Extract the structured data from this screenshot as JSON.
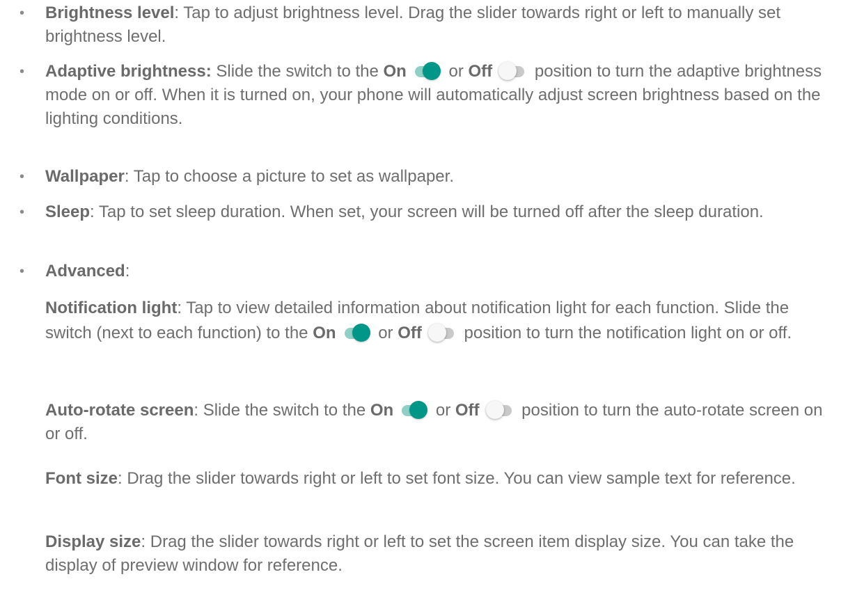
{
  "colors": {
    "text": "#6e6e6e",
    "toggle_on": "#009688",
    "toggle_on_track": "#8fd0c6",
    "toggle_off_track": "#c9c9c9"
  },
  "items": {
    "brightness": {
      "bullet": "•",
      "term": "Brightness level",
      "text": ": Tap to adjust brightness level. Drag the slider towards right or left to manually set brightness level."
    },
    "adaptive": {
      "bullet": "•",
      "term": "Adaptive brightness:",
      "t1": " Slide the switch to the ",
      "on": "On",
      "or": " or ",
      "off": "Off",
      "t2": " position to turn the adaptive brightness mode on or off. When it is turned on, your phone will automatically adjust screen brightness based on the lighting conditions."
    },
    "wallpaper": {
      "bullet": "•",
      "term": "Wallpaper",
      "text": ": Tap to choose a picture to set as wallpaper."
    },
    "sleep": {
      "bullet": "•",
      "term": "Sleep",
      "text": ": Tap to set sleep duration. When set, your screen will be turned off after the sleep duration."
    },
    "advanced": {
      "bullet": "•",
      "term": "Advanced",
      "text": ":"
    },
    "notification": {
      "term": "Notification light",
      "t1": ": Tap to view detailed information about notification light for each function. Slide the switch (next to each function) to the ",
      "on": "On",
      "or": " or ",
      "off": "Off",
      "t2": " position to turn the notification light on or off."
    },
    "autorotate": {
      "term": "Auto-rotate screen",
      "t1": ": Slide the switch to the ",
      "on": "On",
      "or": " or ",
      "off": "Off",
      "t2": " position to turn the auto-rotate screen on or off."
    },
    "fontsize": {
      "term": "Font size",
      "text": ": Drag the slider towards right or left to set font size. You can view sample text for reference."
    },
    "displaysize": {
      "term": "Display size",
      "text": ": Drag the slider towards right or left to set the screen item display size. You can take the display of preview window for reference."
    }
  },
  "toggle_icons": {
    "on": "toggle-on-icon",
    "off": "toggle-off-icon"
  }
}
